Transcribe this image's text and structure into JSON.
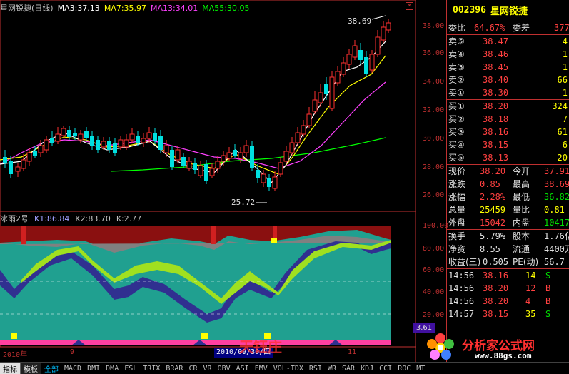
{
  "header": {
    "title": "星网锐捷(日线)",
    "ma": [
      {
        "label": "MA3:37.13",
        "color": "#ffffff"
      },
      {
        "label": "MA7:35.97",
        "color": "#ffff00"
      },
      {
        "label": "MA13:34.01",
        "color": "#ff40ff"
      },
      {
        "label": "MA55:30.05",
        "color": "#00ff00"
      }
    ],
    "close_glyph": "×"
  },
  "price_axis": [
    "38.00",
    "36.00",
    "34.00",
    "32.00",
    "30.00",
    "28.00",
    "26.00"
  ],
  "indicator_axis": [
    "100.00",
    "80.00",
    "60.00",
    "40.00",
    "20.00"
  ],
  "indicator_header": {
    "name": "冰雨2号",
    "k1": "K1:86.84",
    "k2": "K2:83.70",
    "k": "K:2.77"
  },
  "annotations": {
    "high": "38.69",
    "low": "25.72",
    "badge": "3.61"
  },
  "date_axis": {
    "left": "2010年",
    "m9": "9",
    "cursor": "2010/09/30/四",
    "m11": "11"
  },
  "colors": {
    "up": "#ff3030",
    "down": "#00e0e0",
    "ma3": "#ffffff",
    "ma7": "#ffff00",
    "ma13": "#ff40ff",
    "ma55": "#00ff00",
    "border": "#c03030",
    "teal": "#20a090"
  },
  "quote": {
    "code": "002396",
    "name": "星网锐捷",
    "weibi_label": "委比",
    "weibi": "64.67%",
    "weicha_label": "委差",
    "weicha": "377",
    "asks": [
      {
        "label": "卖⑤",
        "price": "38.47",
        "vol": "4"
      },
      {
        "label": "卖④",
        "price": "38.46",
        "vol": "1"
      },
      {
        "label": "卖③",
        "price": "38.45",
        "vol": "1"
      },
      {
        "label": "卖②",
        "price": "38.40",
        "vol": "66"
      },
      {
        "label": "卖①",
        "price": "38.30",
        "vol": "1"
      }
    ],
    "bids": [
      {
        "label": "买①",
        "price": "38.20",
        "vol": "324"
      },
      {
        "label": "买②",
        "price": "38.18",
        "vol": "7"
      },
      {
        "label": "买③",
        "price": "38.16",
        "vol": "61"
      },
      {
        "label": "买④",
        "price": "38.15",
        "vol": "6"
      },
      {
        "label": "买⑤",
        "price": "38.13",
        "vol": "20"
      }
    ],
    "stats": [
      {
        "l1": "现价",
        "v1": "38.20",
        "c1": "red",
        "l2": "今开",
        "v2": "37.91",
        "c2": "red"
      },
      {
        "l1": "涨跌",
        "v1": "0.85",
        "c1": "red",
        "l2": "最高",
        "v2": "38.69",
        "c2": "red"
      },
      {
        "l1": "涨幅",
        "v1": "2.28%",
        "c1": "red",
        "l2": "最低",
        "v2": "36.82",
        "c2": "grn"
      },
      {
        "l1": "总量",
        "v1": "25459",
        "c1": "yel",
        "l2": "量比",
        "v2": "0.81",
        "c2": "yel"
      },
      {
        "l1": "外盘",
        "v1": "15042",
        "c1": "red",
        "l2": "内盘",
        "v2": "10417",
        "c2": "grn"
      }
    ],
    "stats2": [
      {
        "l1": "换手",
        "v1": "5.79%",
        "l2": "股本",
        "v2": "1.76亿"
      },
      {
        "l1": "净资",
        "v1": "8.55",
        "l2": "流通",
        "v2": "4400万"
      },
      {
        "l1": "收益(三)",
        "v1": "0.505",
        "l2": "PE(动)",
        "v2": "56.7"
      }
    ],
    "ticks": [
      {
        "time": "14:56",
        "price": "38.16",
        "vol": "14",
        "side": "S"
      },
      {
        "time": "14:56",
        "price": "38.20",
        "vol": "12",
        "side": "B"
      },
      {
        "time": "14:56",
        "price": "38.20",
        "vol": "4",
        "side": "B"
      },
      {
        "time": "14:57",
        "price": "38.15",
        "vol": "35",
        "side": "S"
      }
    ]
  },
  "toolbar": {
    "items": [
      "指标",
      "模板",
      "全部",
      "MACD",
      "DMI",
      "DMA",
      "FSL",
      "TRIX",
      "BRAR",
      "CR",
      "VR",
      "OBV",
      "ASI",
      "EMV",
      "VOL-TDX",
      "RSI",
      "WR",
      "SAR",
      "KDJ",
      "CCI",
      "ROC",
      "MT"
    ]
  },
  "watermark": {
    "brand": "分析家公式网",
    "url": "www.88gs.com",
    "stamp": "天钰庄"
  }
}
